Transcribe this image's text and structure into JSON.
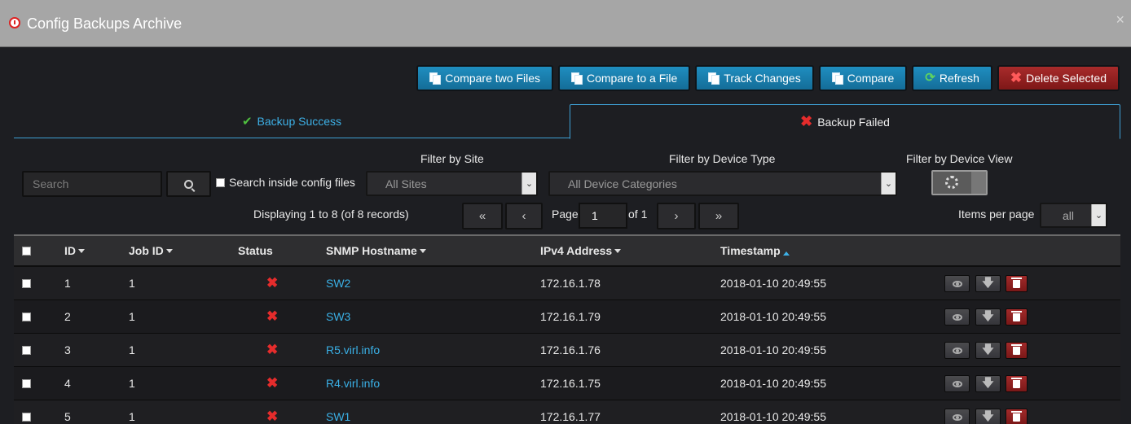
{
  "window": {
    "title": "Config Backups Archive",
    "close_glyph": "×"
  },
  "toolbar": [
    {
      "label": "Compare two Files",
      "icon": "copy-icon",
      "color": "blue"
    },
    {
      "label": "Compare to a File",
      "icon": "copy-icon",
      "color": "blue"
    },
    {
      "label": "Track Changes",
      "icon": "copy-icon",
      "color": "blue"
    },
    {
      "label": "Compare",
      "icon": "copy-icon",
      "color": "blue"
    },
    {
      "label": "Refresh",
      "icon": "refresh-icon",
      "color": "blue"
    },
    {
      "label": "Delete Selected",
      "icon": "x-icon",
      "color": "red"
    }
  ],
  "tabs": {
    "success": "Backup Success",
    "failed": "Backup Failed",
    "active": "failed"
  },
  "filters": {
    "search_placeholder": "Search",
    "search_inside_label": "Search inside config files",
    "site_label": "Filter by Site",
    "site_value": "All Sites",
    "device_type_label": "Filter by Device Type",
    "device_type_value": "All Device Categories",
    "device_view_label": "Filter by Device View"
  },
  "pagination": {
    "info": "Displaying 1 to 8 (of 8 records)",
    "page_label": "Page",
    "page_value": "1",
    "of_label": "of 1",
    "first": "«",
    "prev": "‹",
    "next": "›",
    "last": "»",
    "items_per_page_label": "Items per page",
    "items_per_page_value": "all"
  },
  "table": {
    "headers": {
      "id": "ID",
      "job_id": "Job ID",
      "status": "Status",
      "hostname": "SNMP Hostname",
      "ipv4": "IPv4 Address",
      "timestamp": "Timestamp"
    },
    "rows": [
      {
        "id": "1",
        "job_id": "1",
        "status": "failed",
        "hostname": "SW2",
        "ipv4": "172.16.1.78",
        "timestamp": "2018-01-10 20:49:55"
      },
      {
        "id": "2",
        "job_id": "1",
        "status": "failed",
        "hostname": "SW3",
        "ipv4": "172.16.1.79",
        "timestamp": "2018-01-10 20:49:55"
      },
      {
        "id": "3",
        "job_id": "1",
        "status": "failed",
        "hostname": "R5.virl.info",
        "ipv4": "172.16.1.76",
        "timestamp": "2018-01-10 20:49:55"
      },
      {
        "id": "4",
        "job_id": "1",
        "status": "failed",
        "hostname": "R4.virl.info",
        "ipv4": "172.16.1.75",
        "timestamp": "2018-01-10 20:49:55"
      },
      {
        "id": "5",
        "job_id": "1",
        "status": "failed",
        "hostname": "SW1",
        "ipv4": "172.16.1.77",
        "timestamp": "2018-01-10 20:49:55"
      }
    ]
  },
  "colors": {
    "accent": "#3db0e6",
    "danger": "#e52c2c",
    "button_blue": "#1a7fae",
    "button_red": "#922222"
  }
}
